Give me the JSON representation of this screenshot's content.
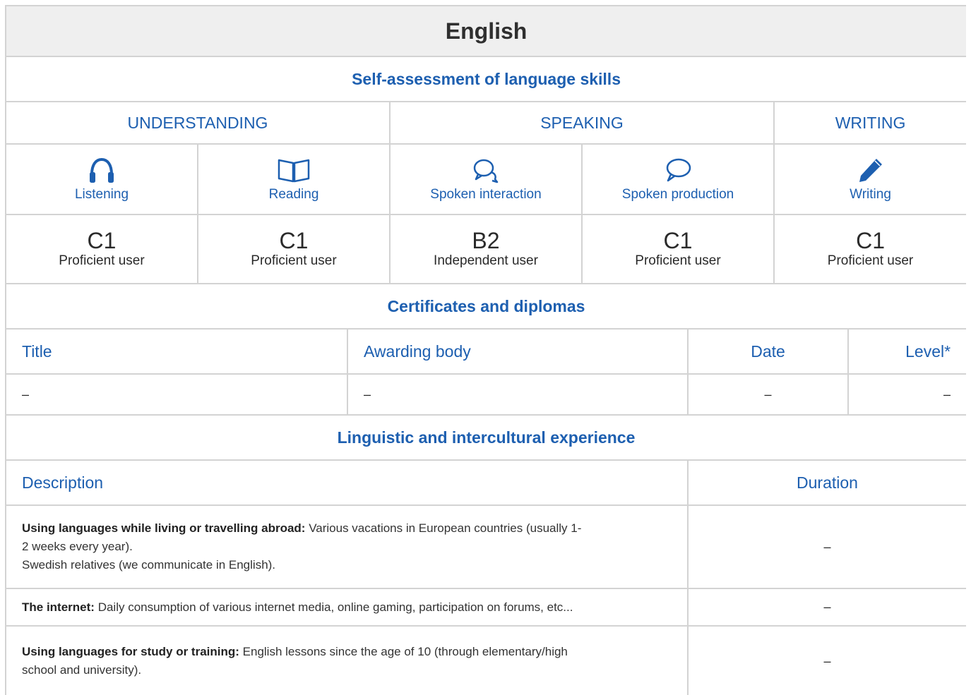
{
  "title": "English",
  "self_assessment": {
    "heading": "Self-assessment of language skills",
    "categories": [
      "UNDERSTANDING",
      "SPEAKING",
      "WRITING"
    ],
    "skills": [
      {
        "label": "Listening",
        "icon": "headphones-icon",
        "level": "C1",
        "level_desc": "Proficient user"
      },
      {
        "label": "Reading",
        "icon": "book-icon",
        "level": "C1",
        "level_desc": "Proficient user"
      },
      {
        "label": "Spoken interaction",
        "icon": "chat-bubbles-icon",
        "level": "B2",
        "level_desc": "Independent user"
      },
      {
        "label": "Spoken production",
        "icon": "speech-bubble-icon",
        "level": "C1",
        "level_desc": "Proficient user"
      },
      {
        "label": "Writing",
        "icon": "pencil-icon",
        "level": "C1",
        "level_desc": "Proficient user"
      }
    ]
  },
  "certificates": {
    "heading": "Certificates and diplomas",
    "columns": [
      "Title",
      "Awarding body",
      "Date",
      "Level*"
    ],
    "rows": [
      [
        "–",
        "–",
        "–",
        "–"
      ]
    ]
  },
  "experience": {
    "heading": "Linguistic and intercultural experience",
    "columns": [
      "Description",
      "Duration"
    ],
    "rows": [
      {
        "label": "Using languages while living or travelling abroad:",
        "lines": [
          "Various vacations in European countries (usually 1-",
          "2 weeks every year).",
          "Swedish relatives (we communicate in English)."
        ],
        "duration": "–"
      },
      {
        "label": "The internet:",
        "lines": [
          "Daily consumption of various internet media, online gaming, participation on forums, etc..."
        ],
        "duration": "–"
      },
      {
        "label": "Using languages for study or training:",
        "lines": [
          "English lessons since the age of 10 (through elementary/high",
          "school and university)."
        ],
        "duration": "–"
      }
    ]
  },
  "colors": {
    "accent": "#1d5fb0",
    "border": "#d3d3d3",
    "title_bg": "#efefef"
  }
}
